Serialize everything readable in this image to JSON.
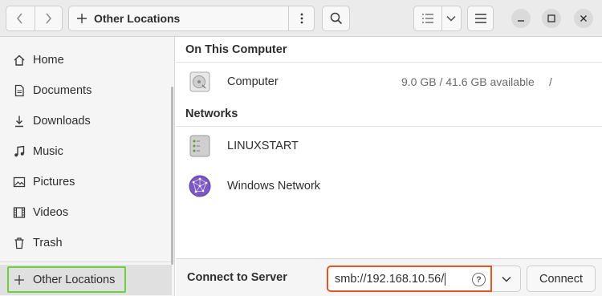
{
  "header": {
    "back_icon": "chevron-left-icon",
    "forward_icon": "chevron-right-icon",
    "location_icon": "plus-icon",
    "location_label": "Other Locations",
    "path_menu_icon": "vertical-ellipsis-icon",
    "search_icon": "search-icon",
    "view_icon": "list-view-icon",
    "view_options_icon": "chevron-down-icon",
    "main_menu_icon": "hamburger-menu-icon",
    "minimize_icon": "minimize-icon",
    "maximize_icon": "maximize-icon",
    "close_icon": "close-icon"
  },
  "sidebar": {
    "items": [
      {
        "label": "Home",
        "icon": "home-icon"
      },
      {
        "label": "Documents",
        "icon": "document-icon"
      },
      {
        "label": "Downloads",
        "icon": "download-icon"
      },
      {
        "label": "Music",
        "icon": "music-icon"
      },
      {
        "label": "Pictures",
        "icon": "picture-icon"
      },
      {
        "label": "Videos",
        "icon": "video-icon"
      },
      {
        "label": "Trash",
        "icon": "trash-icon"
      }
    ],
    "other_locations": {
      "label": "Other Locations",
      "icon": "plus-icon",
      "selected": true
    },
    "highlight_color": "#6ccf3c"
  },
  "main": {
    "on_this_computer": "On This Computer",
    "computer": {
      "name": "Computer",
      "available": "9.0 GB / 41.6 GB available",
      "mount": "/",
      "icon": "hard-drive-icon"
    },
    "networks": "Networks",
    "network_items": [
      {
        "name": "LINUXSTART",
        "icon": "server-icon"
      },
      {
        "name": "Windows Network",
        "icon": "network-globe-icon"
      }
    ]
  },
  "actionbar": {
    "label": "Connect to Server",
    "server_value": "smb://192.168.10.56/",
    "help_icon": "help-icon",
    "dropdown_icon": "chevron-down-icon",
    "connect_label": "Connect"
  },
  "colors": {
    "accent": "#e95420",
    "header_bg": "#ebebeb",
    "sidebar_bg": "#f5f5f5",
    "highlight": "#6ccf3c"
  }
}
